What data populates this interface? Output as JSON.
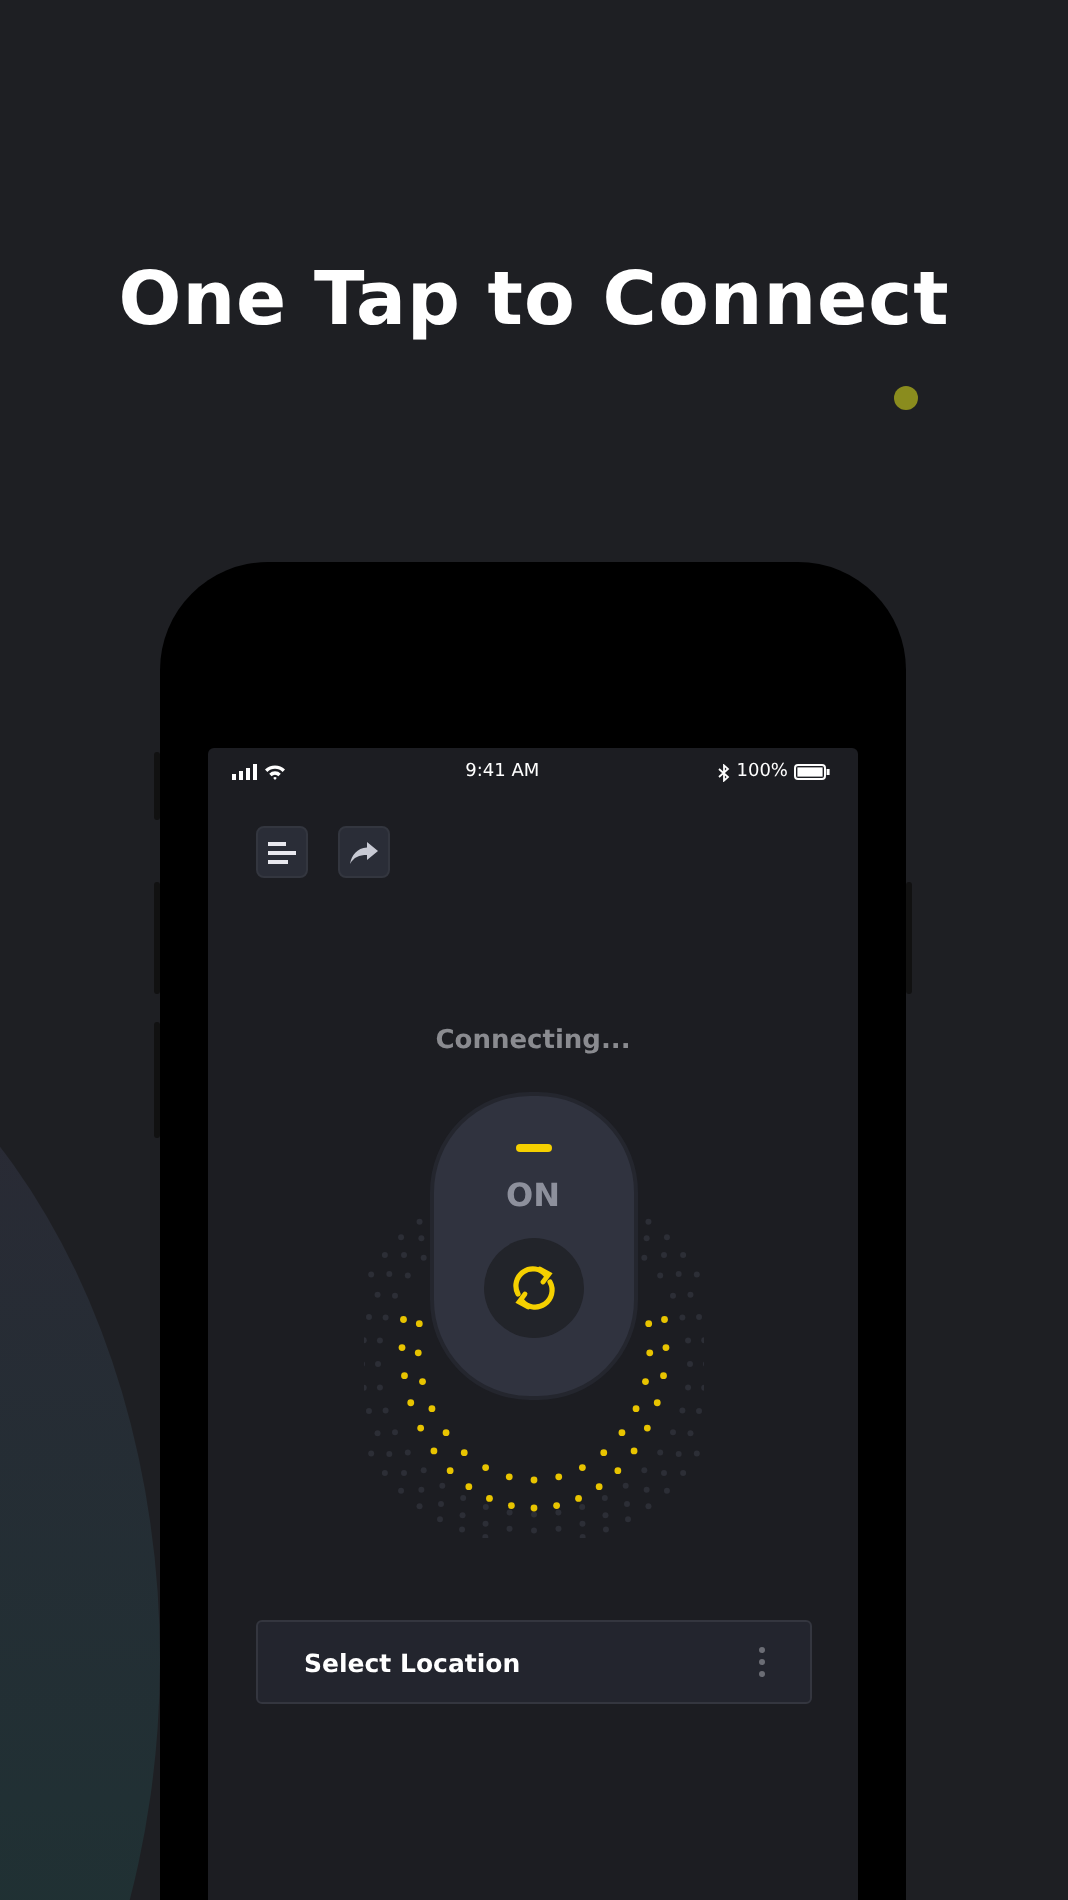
{
  "headline": "One Tap to Connect",
  "status_bar": {
    "time": "9:41 AM",
    "battery": "100%"
  },
  "status": "Connecting...",
  "toggle": {
    "label": "ON",
    "on": true
  },
  "location": {
    "label": "Select Location"
  }
}
